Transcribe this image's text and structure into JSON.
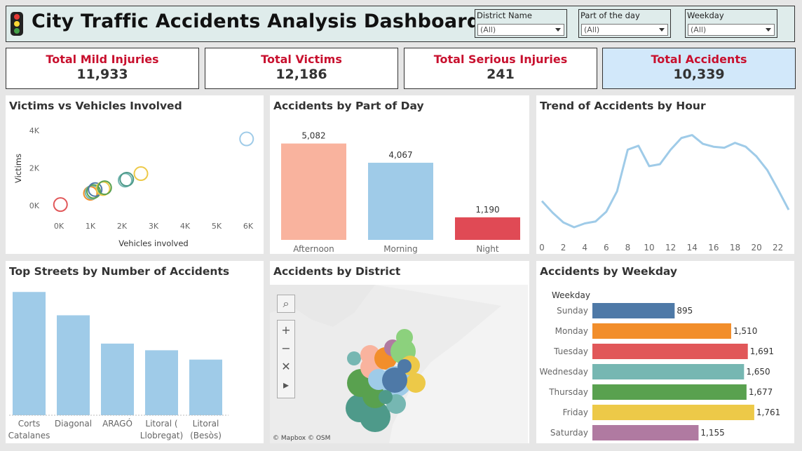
{
  "header": {
    "title": "City Traffic Accidents Analysis Dashboard",
    "filters": [
      {
        "label": "District Name",
        "value": "(All)"
      },
      {
        "label": "Part of the day",
        "value": "(All)"
      },
      {
        "label": "Weekday",
        "value": "(All)"
      }
    ]
  },
  "kpis": [
    {
      "label": "Total Mild Injuries",
      "value": "11,933"
    },
    {
      "label": "Total Victims",
      "value": "12,186"
    },
    {
      "label": "Total Serious Injuries",
      "value": "241"
    },
    {
      "label": "Total Accidents",
      "value": "10,339"
    }
  ],
  "colors": {
    "kpi_label": "#c8102e",
    "accent_panel": "#d2e8fa",
    "bar_blue": "#9fcbe8",
    "afternoon": "#f9b39e",
    "night": "#e04a55"
  },
  "panels": {
    "scatter": {
      "title": "Victims vs Vehicles Involved"
    },
    "part_of_day": {
      "title": "Accidents by Part of Day"
    },
    "trend": {
      "title": "Trend of Accidents by Hour"
    },
    "streets": {
      "title": "Top Streets by Number of Accidents"
    },
    "district": {
      "title": "Accidents by District",
      "attribution": "© Mapbox © OSM"
    },
    "weekday": {
      "title": "Accidents by Weekday"
    }
  },
  "chart_data": [
    {
      "id": "scatter",
      "type": "scatter",
      "title": "Victims vs Vehicles Involved",
      "xlabel": "Vehicles involved",
      "ylabel": "Victims",
      "xlim": [
        0,
        6000
      ],
      "ylim": [
        0,
        4000
      ],
      "xticks": [
        "0K",
        "1K",
        "2K",
        "3K",
        "4K",
        "5K",
        "6K"
      ],
      "yticks": [
        "0K",
        "2K",
        "4K"
      ],
      "points": [
        {
          "x": 50,
          "y": 50,
          "color": "#e15759"
        },
        {
          "x": 1000,
          "y": 650,
          "color": "#f28e2b"
        },
        {
          "x": 1050,
          "y": 700,
          "color": "#76b7b2"
        },
        {
          "x": 1100,
          "y": 750,
          "color": "#59a14f"
        },
        {
          "x": 1150,
          "y": 850,
          "color": "#4e79a7"
        },
        {
          "x": 1400,
          "y": 900,
          "color": "#edc948"
        },
        {
          "x": 1450,
          "y": 950,
          "color": "#59a14f"
        },
        {
          "x": 2100,
          "y": 1350,
          "color": "#76b7b2"
        },
        {
          "x": 2150,
          "y": 1400,
          "color": "#4e9a8a"
        },
        {
          "x": 2600,
          "y": 1700,
          "color": "#edc948"
        },
        {
          "x": 5950,
          "y": 3550,
          "color": "#9fcbe8"
        }
      ]
    },
    {
      "id": "part_of_day",
      "type": "bar",
      "title": "Accidents by Part of Day",
      "categories": [
        "Afternoon",
        "Morning",
        "Night"
      ],
      "values": [
        5082,
        4067,
        1190
      ],
      "labels": [
        "5,082",
        "4,067",
        "1,190"
      ],
      "colors": [
        "#f9b39e",
        "#9fcbe8",
        "#e04a55"
      ],
      "ylim": [
        0,
        5400
      ]
    },
    {
      "id": "trend",
      "type": "line",
      "title": "Trend of Accidents by Hour",
      "x": [
        0,
        1,
        2,
        3,
        4,
        5,
        6,
        7,
        8,
        9,
        10,
        11,
        12,
        13,
        14,
        15,
        16,
        17,
        18,
        19,
        20,
        21,
        22,
        23
      ],
      "values": [
        200,
        140,
        90,
        65,
        85,
        95,
        145,
        250,
        465,
        485,
        380,
        390,
        465,
        525,
        540,
        495,
        480,
        475,
        500,
        480,
        430,
        360,
        260,
        155
      ],
      "ylim": [
        0,
        600
      ],
      "xticks": [
        "0",
        "2",
        "4",
        "6",
        "8",
        "10",
        "12",
        "14",
        "16",
        "18",
        "20",
        "22"
      ]
    },
    {
      "id": "streets",
      "type": "bar",
      "title": "Top Streets by Number of Accidents",
      "categories": [
        "Corts Catalanes",
        "Diagonal",
        "ARAGÓ",
        "Litoral ( Llobregat)",
        "Litoral (Besòs)"
      ],
      "category_lines": [
        [
          "Corts",
          "Catalanes"
        ],
        [
          "Diagonal"
        ],
        [
          "ARAGÓ"
        ],
        [
          "Litoral (",
          "Llobregat)"
        ],
        [
          "Litoral",
          "(Besòs)"
        ]
      ],
      "values": [
        370,
        300,
        215,
        195,
        167
      ],
      "ylim": [
        0,
        400
      ]
    },
    {
      "id": "weekday",
      "type": "bar",
      "orientation": "horizontal",
      "title": "Accidents by Weekday",
      "axis_label": "Weekday",
      "categories": [
        "Sunday",
        "Monday",
        "Tuesday",
        "Wednesday",
        "Thursday",
        "Friday",
        "Saturday"
      ],
      "values": [
        895,
        1510,
        1691,
        1650,
        1677,
        1761,
        1155
      ],
      "labels": [
        "895",
        "1,510",
        "1,691",
        "1,650",
        "1,677",
        "1,761",
        "1,155"
      ],
      "colors": [
        "#4e79a7",
        "#f28e2b",
        "#e15759",
        "#76b7b2",
        "#59a14f",
        "#edc948",
        "#b07aa1"
      ],
      "xlim": [
        0,
        1800
      ]
    }
  ]
}
